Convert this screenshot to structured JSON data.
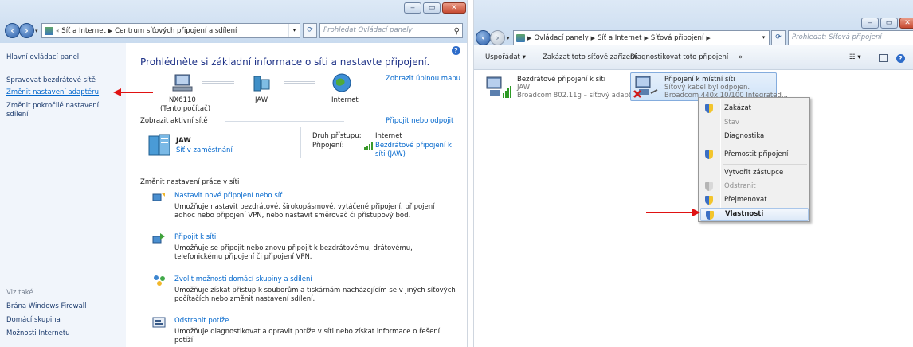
{
  "left": {
    "address": {
      "part1": "Síť a Internet",
      "part2": "Centrum síťových připojení a sdílení"
    },
    "search_placeholder": "Prohledat Ovládací panely",
    "sidebar": {
      "home": "Hlavní ovládací panel",
      "items": [
        "Spravovat bezdrátové sítě",
        "Změnit nastavení adaptéru",
        "Změnit pokročilé nastavení",
        "sdílení"
      ],
      "see_also_header": "Viz také",
      "see_also": [
        "Brána Windows Firewall",
        "Domácí skupina",
        "Možnosti Internetu"
      ]
    },
    "main": {
      "title": "Prohlédněte si základní informace o síti a nastavte připojení.",
      "full_map": "Zobrazit úplnou mapu",
      "nodes": [
        "NX6110",
        "(Tento počítač)",
        "JAW",
        "Internet"
      ],
      "active_header": "Zobrazit aktivní sítě",
      "connect_link": "Připojit nebo odpojit",
      "network_name": "JAW",
      "network_type": "Síť v zaměstnání",
      "access_label": "Druh přístupu:",
      "access_value": "Internet",
      "conn_label": "Připojení:",
      "conn_value_1": "Bezdrátové připojení k",
      "conn_value_2": "síti (JAW)",
      "change_header": "Změnit nastavení práce v síti",
      "tasks": [
        {
          "title": "Nastavit nové připojení nebo síť",
          "desc": "Umožňuje nastavit bezdrátové, širokopásmové, vytáčené připojení, připojení adhoc nebo připojení VPN, nebo nastavit směrovač či přístupový bod."
        },
        {
          "title": "Připojit k síti",
          "desc": "Umožňuje se připojit nebo znovu připojit k bezdrátovému, drátovému, telefonickému připojení či připojení VPN."
        },
        {
          "title": "Zvolit možnosti domácí skupiny a sdílení",
          "desc": "Umožňuje získat přístup k souborům a tiskárnám nacházejícím se v jiných síťových počítačích nebo změnit nastavení sdílení."
        },
        {
          "title": "Odstranit potíže",
          "desc": "Umožňuje diagnostikovat a opravit potíže v síti nebo získat informace o řešení potíží."
        }
      ]
    }
  },
  "right": {
    "address": {
      "part1": "Ovládací panely",
      "part2": "Síť a Internet",
      "part3": "Síťová připojení"
    },
    "search_placeholder": "Prohledat: Síťová připojení",
    "toolbar": {
      "organize": "Uspořádat",
      "disable": "Zakázat toto síťové zařízení",
      "diagnose": "Diagnostikovat toto připojení",
      "more": "»"
    },
    "adapters": [
      {
        "name": "Bezdrátové připojení k síti",
        "line2": "JAW",
        "line3": "Broadcom 802.11g – síťový adaptér"
      },
      {
        "name": "Připojení k místní síti",
        "line2": "Síťový kabel byl odpojen.",
        "line3": "Broadcom 440x 10/100 Integrated..."
      }
    ],
    "context_menu": [
      "Zakázat",
      "Stav",
      "Diagnostika",
      "Přemostit připojení",
      "Vytvořit zástupce",
      "Odstranit",
      "Přejmenovat",
      "Vlastnosti"
    ]
  },
  "icons": {
    "back": "back-arrow-icon",
    "forward": "forward-arrow-icon",
    "search": "magnifier-icon",
    "help": "help-icon",
    "shield": "uac-shield-icon"
  },
  "colors": {
    "arrow": "#e01212",
    "link": "#0066cc",
    "title": "#1e3287"
  }
}
